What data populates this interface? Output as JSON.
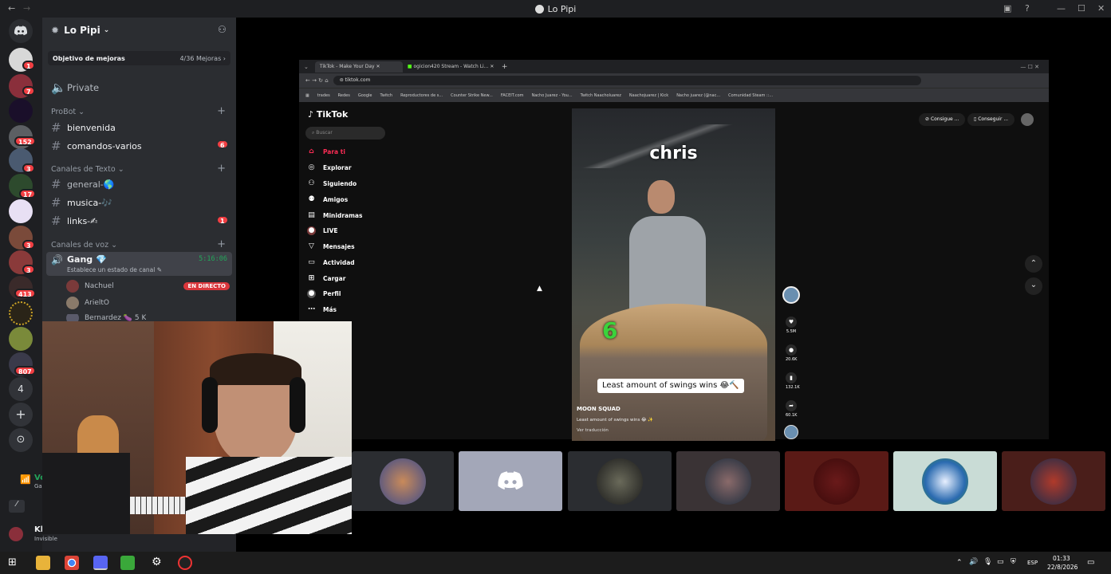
{
  "window": {
    "title": "Lo Pipi"
  },
  "server": {
    "name": "Lo Pipi",
    "boost_label": "Objetivo de mejoras",
    "boost_progress": "4/36 Mejoras"
  },
  "guild_badges": [
    "1",
    "7",
    "152",
    "3",
    "17",
    "3",
    "3",
    "413",
    "807",
    "4"
  ],
  "channels": {
    "private": "Private",
    "cat_probot": "ProBot",
    "bienvenida": "bienvenida",
    "comandos": "comandos-varios",
    "comandos_badge": "6",
    "cat_text": "Canales de Texto",
    "general": "general-🌎",
    "musica": "musica-🎶",
    "links": "links-✍",
    "links_badge": "1",
    "cat_voice": "Canales de voz",
    "voice_name": "Gang 💎",
    "voice_timer": "5:16:06",
    "voice_status": "Establece un estado de canal",
    "users": [
      {
        "name": "Nachuel",
        "badge": "EN DIRECTO"
      },
      {
        "name": "ArieltO",
        "badge": ""
      },
      {
        "name": "Bernardez 🍆 5 K",
        "badge": ""
      }
    ]
  },
  "user_panel": {
    "status": "Invisible",
    "voice_prefix": "Vo",
    "voice_sub": "Ga",
    "user_prefix": "Kl"
  },
  "browser": {
    "tabs": [
      "TikTok - Make Your Day",
      "ogicion420 Stream - Watch Li..."
    ],
    "url": "tiktok.com",
    "bookmarks": [
      "trades",
      "Redes",
      "Google",
      "Twitch",
      "Reproductores de s...",
      "Counter Strike New...",
      "FACEIT.com",
      "Nacho Juarez - You...",
      "Twitch Naacholuarez",
      "Naachojuarez | Kick",
      "Nacho juarez (@nac...",
      "Comunidad Steam ::..."
    ]
  },
  "tiktok": {
    "logo": "TikTok",
    "search_placeholder": "Buscar",
    "nav": [
      "Para ti",
      "Explorar",
      "Siguiendo",
      "Amigos",
      "Minidramas",
      "LIVE",
      "Mensajes",
      "Actividad",
      "Cargar",
      "Perfil",
      "Más"
    ],
    "btn_coins": "Consigue ...",
    "btn_app": "Conseguir ...",
    "video_title": "chris",
    "video_number": "6",
    "video_caption": "Least amount of swings wins 😂🔨",
    "video_author": "MOON SQUAD",
    "video_desc": "Least amount of swings wins 😂 ✨",
    "video_translate": "Ver traducción",
    "likes": "5.5M",
    "comments": "20.6K",
    "saves": "132.1K",
    "shares": "60.1K"
  },
  "taskbar": {
    "lang": "ESP",
    "time": "01:33",
    "date": "22/8/2026"
  }
}
